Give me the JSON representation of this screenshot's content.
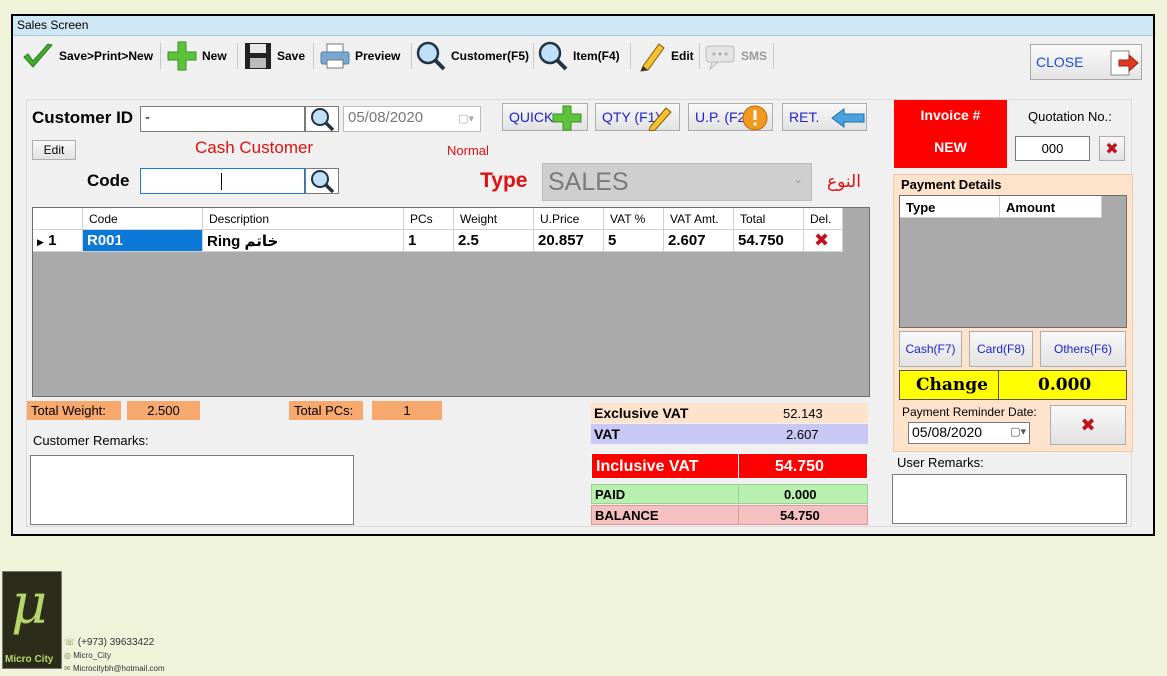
{
  "window": {
    "title": "Sales Screen"
  },
  "toolbar": {
    "save_print_new": "Save>Print>New",
    "new": "New",
    "save": "Save",
    "preview": "Preview",
    "customer": "Customer(F5)",
    "item": "Item(F4)",
    "edit": "Edit",
    "sms": "SMS",
    "close": "CLOSE"
  },
  "form": {
    "customer_id_label": "Customer ID",
    "customer_id_value": "-",
    "date_value": "05/08/2020",
    "edit_button": "Edit",
    "customer_name": "Cash Customer",
    "customer_type": "Normal",
    "code_label": "Code",
    "code_value": "",
    "type_label": "Type",
    "type_label_arabic": "النوع",
    "type_value": "SALES",
    "quick_button": "QUICK",
    "qty_button": "QTY (F1)",
    "up_button": "U.P. (F2)",
    "ret_button": "RET."
  },
  "invoice": {
    "label": "Invoice #",
    "value": "NEW",
    "quotation_label": "Quotation No.:",
    "quotation_value": "000"
  },
  "grid": {
    "columns": [
      "Code",
      "Description",
      "PCs",
      "Weight",
      "U.Price",
      "VAT %",
      "VAT Amt.",
      "Total",
      "Del."
    ],
    "rows": [
      {
        "row_num": "1",
        "code": "R001",
        "description": "Ring خاتم",
        "pcs": "1",
        "weight": "2.5",
        "u_price": "20.857",
        "vat_pct": "5",
        "vat_amt": "2.607",
        "total": "54.750"
      }
    ]
  },
  "totals": {
    "total_weight_label": "Total  Weight:",
    "total_weight_value": "2.500",
    "total_pcs_label": "Total PCs:",
    "total_pcs_value": "1",
    "exclusive_vat_label": "Exclusive VAT",
    "exclusive_vat_value": "52.143",
    "vat_label": "VAT",
    "vat_value": "2.607",
    "inclusive_vat_label": "Inclusive VAT",
    "inclusive_vat_value": "54.750",
    "paid_label": "PAID",
    "paid_value": "0.000",
    "balance_label": "BALANCE",
    "balance_value": "54.750"
  },
  "remarks": {
    "customer_label": "Customer Remarks:",
    "user_label": "User Remarks:"
  },
  "payment": {
    "title": "Payment Details",
    "columns": [
      "Type",
      "Amount"
    ],
    "cash_button": "Cash(F7)",
    "card_button": "Card(F8)",
    "others_button": "Others(F6)",
    "change_label": "Change",
    "change_value": "0.000",
    "reminder_label": "Payment Reminder Date:",
    "reminder_date": "05/08/2020"
  },
  "footer": {
    "logo_symbol": "μ",
    "logo_text": "Micro City",
    "phone": "(+973) 39633422",
    "instagram": "Micro_City",
    "email": "Microcitybh@hotmail.com"
  },
  "colors": {
    "invoice_red": "#ff0000",
    "label_red": "#e01010",
    "orange": "#f7a86d",
    "change_yellow": "#ffff00",
    "paid_green": "#b8f0b0",
    "balance_pink": "#f5c0c0",
    "vat_lavender": "#c8c8f5",
    "excl_peach": "#fde3cc"
  }
}
